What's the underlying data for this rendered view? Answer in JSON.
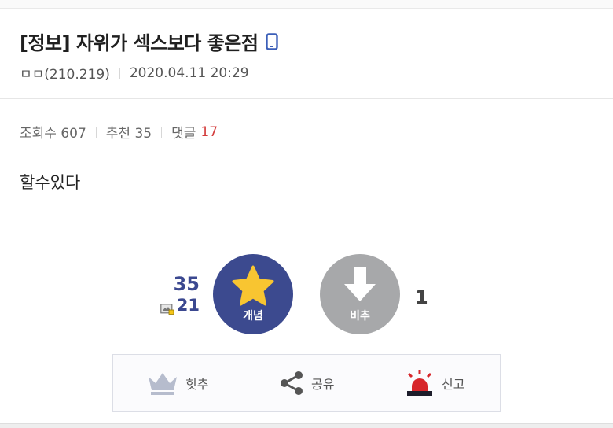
{
  "post": {
    "title": "[정보] 자위가 섹스보다 좋은점",
    "author": "ㅁㅁ(210.219)",
    "datetime": "2020.04.11 20:29",
    "views_label": "조회수 607",
    "recommend_label": "추천 35",
    "comments_label": "댓글",
    "comments_count": "17",
    "body": "할수있다"
  },
  "vote": {
    "up_count": "35",
    "fixed_up_count": "21",
    "up_label": "개념",
    "down_label": "비추",
    "down_count": "1"
  },
  "actions": {
    "hit_label": "힛추",
    "share_label": "공유",
    "report_label": "신고"
  },
  "colors": {
    "accent_blue": "#3c4a8f",
    "star_yellow": "#f8c531",
    "comment_red": "#d33b3b",
    "report_red": "#d7262b",
    "down_gray": "#a7a8aa"
  },
  "icons": {
    "device": "mobile-phone-icon",
    "fixed": "gallery-fix-icon",
    "up": "star-icon",
    "down": "down-arrow-icon",
    "hit": "crown-icon",
    "share": "share-icon",
    "report": "siren-icon"
  }
}
